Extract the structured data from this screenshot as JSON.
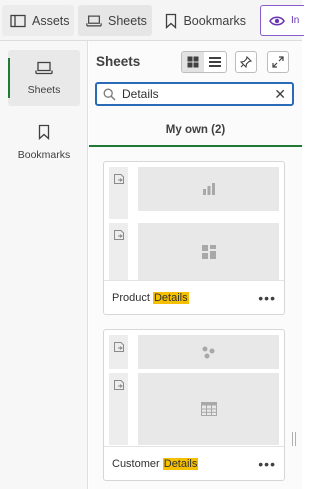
{
  "toolbar": {
    "assets_label": "Assets",
    "sheets_label": "Sheets",
    "bookmarks_label": "Bookmarks",
    "insights_label": "In"
  },
  "rail": {
    "items": [
      {
        "label": "Sheets",
        "icon": "sheet-icon"
      },
      {
        "label": "Bookmarks",
        "icon": "bookmark-icon"
      }
    ]
  },
  "panel": {
    "title": "Sheets",
    "search_value": "Details",
    "tab_label": "My own (2)"
  },
  "sheets": [
    {
      "name_prefix": "Product ",
      "name_highlight": "Details"
    },
    {
      "name_prefix": "Customer ",
      "name_highlight": "Details"
    }
  ],
  "colors": {
    "accent_green": "#1f7a36",
    "search_border": "#2a6ab6",
    "highlight": "#f5c000",
    "insights_purple": "#8a5cc7"
  }
}
